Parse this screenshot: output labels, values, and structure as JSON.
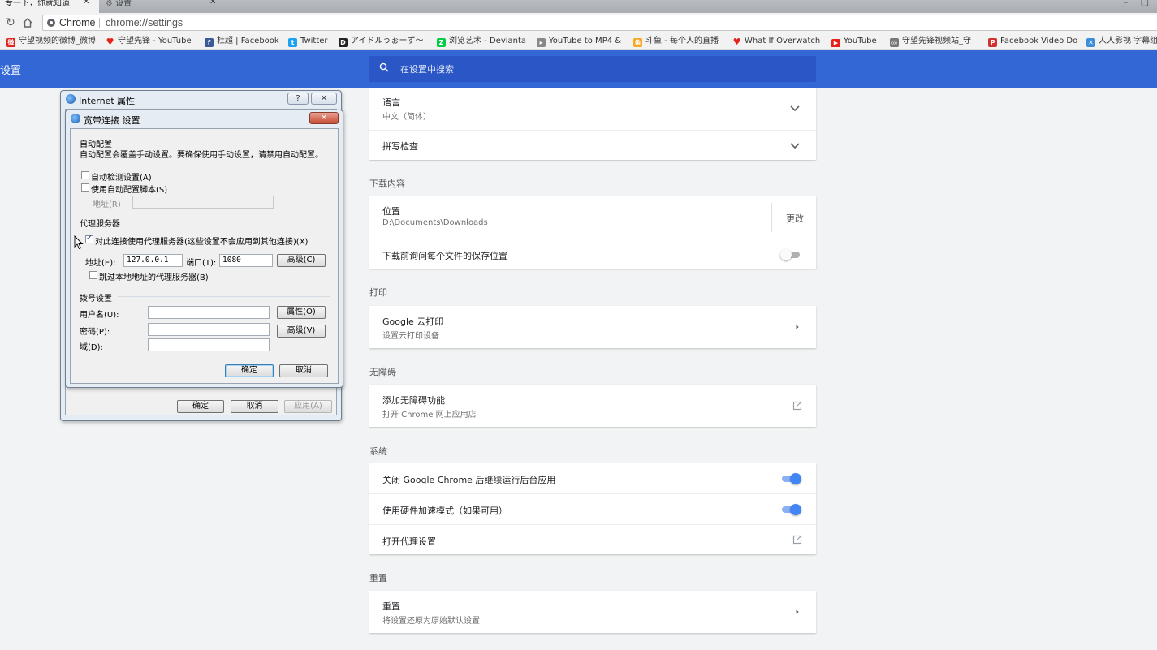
{
  "tabs": [
    {
      "title": "专一下，你就知道",
      "close": "✕"
    },
    {
      "title": "设置",
      "close": "✕"
    }
  ],
  "window_controls": "– ▢",
  "omnibox": {
    "site_name": "Chrome",
    "url": "chrome://settings"
  },
  "bookmarks": [
    {
      "label": "守望视频的微博_微博",
      "color": "#e2231a",
      "glyph": "微"
    },
    {
      "label": "守望先锋 - YouTube",
      "color": "#e62117",
      "glyph": "♥"
    },
    {
      "label": "杜超 | Facebook",
      "color": "#3b5998",
      "glyph": "f"
    },
    {
      "label": "Twitter",
      "color": "#1da1f2",
      "glyph": "t"
    },
    {
      "label": "アイドルうぉーず～",
      "color": "#222222",
      "glyph": "D"
    },
    {
      "label": "浏览艺术 - Devianta",
      "color": "#05cc47",
      "glyph": "Z"
    },
    {
      "label": "YouTube to MP4 &",
      "color": "#888888",
      "glyph": "▸"
    },
    {
      "label": "斗鱼 - 每个人的直播",
      "color": "#f6a623",
      "glyph": "鱼"
    },
    {
      "label": "What If Overwatch",
      "color": "#e62117",
      "glyph": "♥"
    },
    {
      "label": "YouTube",
      "color": "#e62117",
      "glyph": "▶"
    },
    {
      "label": "守望先锋视频站_守",
      "color": "#777777",
      "glyph": "◎"
    },
    {
      "label": "Facebook Video Do",
      "color": "#d2322d",
      "glyph": "P"
    },
    {
      "label": "人人影视 字幕组",
      "color": "#3b8fd9",
      "glyph": "✕"
    }
  ],
  "settings": {
    "title": "设置",
    "search_placeholder": "在设置中搜索",
    "language": {
      "label": "语言",
      "value": "中文（简体）"
    },
    "spellcheck": {
      "label": "拼写检查"
    },
    "downloads": {
      "section": "下载内容",
      "location_label": "位置",
      "location_value": "D:\\Documents\\Downloads",
      "change_label": "更改",
      "ask_label": "下载前询问每个文件的保存位置",
      "ask_enabled": false
    },
    "printing": {
      "section": "打印",
      "cloud_label": "Google 云打印",
      "cloud_sub": "设置云打印设备"
    },
    "accessibility": {
      "section": "无障碍",
      "add_label": "添加无障碍功能",
      "add_sub": "打开 Chrome 网上应用店"
    },
    "system": {
      "section": "系统",
      "background_label": "关闭 Google Chrome 后继续运行后台应用",
      "background_enabled": true,
      "hw_label": "使用硬件加速模式（如果可用）",
      "hw_enabled": true,
      "proxy_label": "打开代理设置"
    },
    "reset": {
      "section": "重置",
      "label": "重置",
      "sub": "将设置还原为原始默认设置"
    }
  },
  "internet_props": {
    "title": "Internet 属性",
    "help_btn": "?",
    "close_btn": "✕",
    "ok": "确定",
    "cancel": "取消",
    "apply": "应用(A)"
  },
  "lan_dialog": {
    "title": "宽带连接 设置",
    "close_btn": "✕",
    "auto_config_heading": "自动配置",
    "auto_config_desc": "自动配置会覆盖手动设置。要确保使用手动设置，请禁用自动配置。",
    "auto_detect": {
      "label": "自动检测设置(A)",
      "checked": false
    },
    "auto_script": {
      "label": "使用自动配置脚本(S)",
      "checked": false
    },
    "address_label_disabled": "地址(R)",
    "address_value_disabled": "",
    "proxy_heading": "代理服务器",
    "use_proxy": {
      "label": "对此连接使用代理服务器(这些设置不会应用到其他连接)(X)",
      "checked": true
    },
    "proxy_address_label": "地址(E):",
    "proxy_address_value": "127.0.0.1",
    "proxy_port_label": "端口(T):",
    "proxy_port_value": "1080",
    "advanced_btn": "高级(C)",
    "bypass_local": {
      "label": "跳过本地地址的代理服务器(B)",
      "checked": false
    },
    "dialup_heading": "拨号设置",
    "username_label": "用户名(U):",
    "username_value": "",
    "properties_btn": "属性(O)",
    "password_label": "密码(P):",
    "password_value": "",
    "advanced_v_btn": "高级(V)",
    "domain_label": "域(D):",
    "domain_value": "",
    "ok": "确定",
    "cancel": "取消"
  },
  "colors": {
    "header_blue": "#3367d6",
    "toggle_on": "#4285f4"
  }
}
